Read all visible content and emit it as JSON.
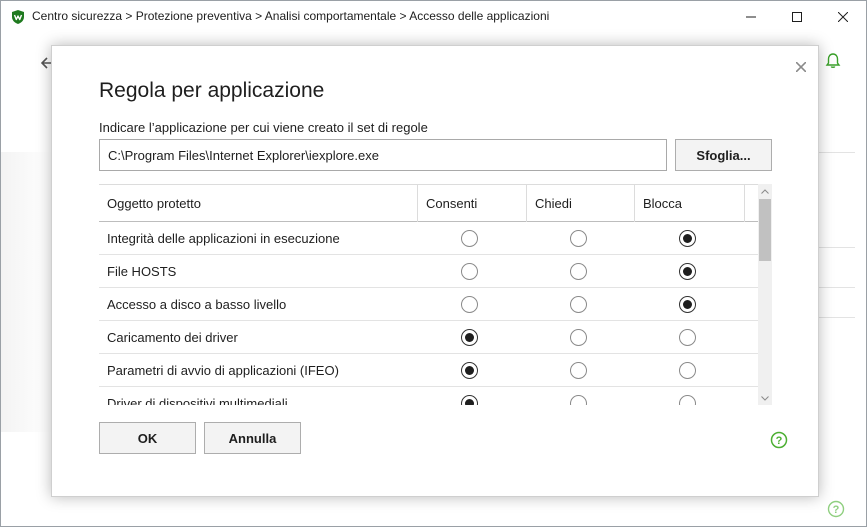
{
  "window": {
    "breadcrumb": "Centro sicurezza > Protezione preventiva > Analisi comportamentale > Accesso delle applicazioni"
  },
  "colors": {
    "accent": "#3aa02a",
    "help_green": "#4caf32"
  },
  "icons": {
    "logo": "app-logo-icon",
    "minimize": "minimize-icon",
    "maximize": "maximize-icon",
    "close": "close-icon",
    "back": "back-arrow-icon",
    "bell": "bell-icon",
    "help": "help-icon"
  },
  "dialog": {
    "title": "Regola per applicazione",
    "label": "Indicare l’applicazione per cui viene creato il set di regole",
    "path_value": "C:\\Program Files\\Internet Explorer\\iexplore.exe",
    "browse_label": "Sfoglia...",
    "ok_label": "OK",
    "cancel_label": "Annulla",
    "table": {
      "columns": [
        "Oggetto protetto",
        "Consenti",
        "Chiedi",
        "Blocca"
      ],
      "rows": [
        {
          "name": "Integrità delle applicazioni in esecuzione",
          "selected": "Blocca"
        },
        {
          "name": "File HOSTS",
          "selected": "Blocca"
        },
        {
          "name": "Accesso a disco a basso livello",
          "selected": "Blocca"
        },
        {
          "name": "Caricamento dei driver",
          "selected": "Consenti"
        },
        {
          "name": "Parametri di avvio di applicazioni (IFEO)",
          "selected": "Consenti"
        },
        {
          "name": "Driver di dispositivi multimediali",
          "selected": "Consenti"
        }
      ]
    }
  }
}
